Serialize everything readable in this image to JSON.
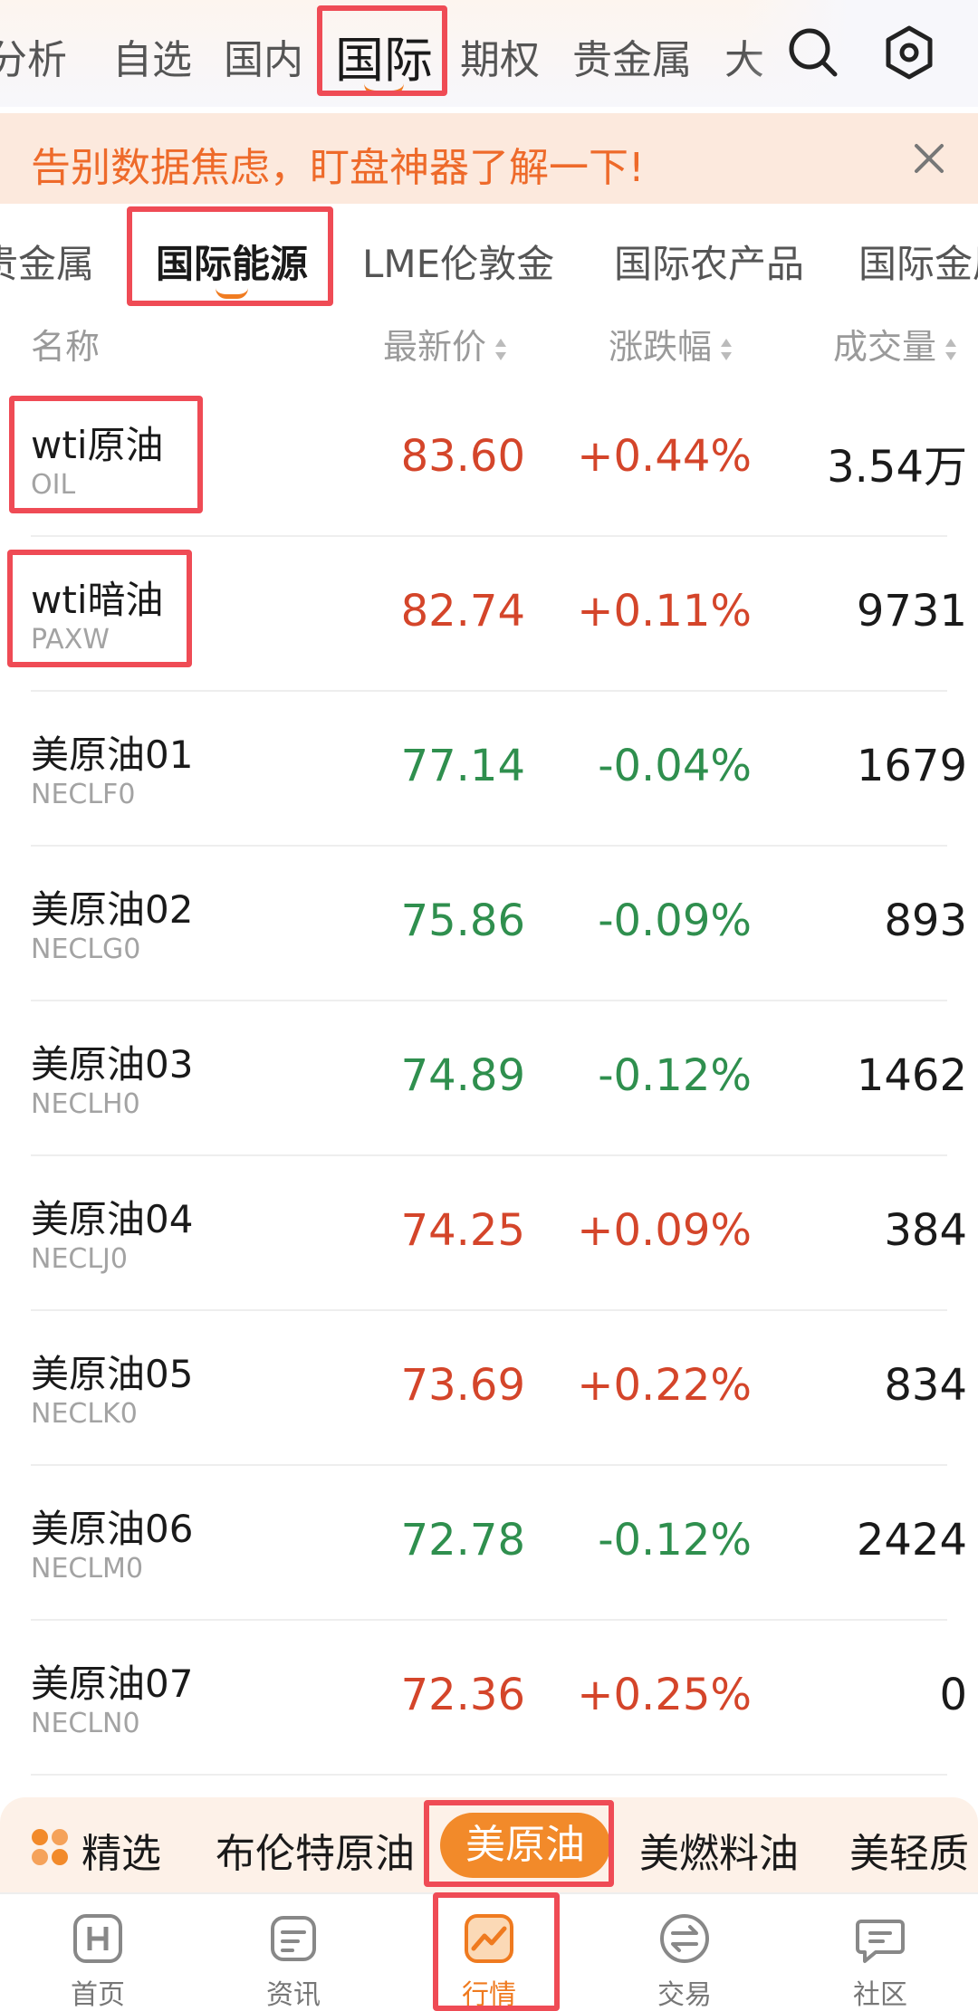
{
  "top_tabs": {
    "items": [
      "分析",
      "自选",
      "国内",
      "国际",
      "期权",
      "贵金属",
      "大"
    ],
    "active_index": 3
  },
  "banner": {
    "text": "告别数据焦虑，盯盘神器了解一下!"
  },
  "sub_tabs": {
    "items": [
      "贵金属",
      "国际能源",
      "LME伦敦金",
      "国际农产品",
      "国际金属"
    ],
    "active_index": 1
  },
  "columns": {
    "name": "名称",
    "price": "最新价",
    "change": "涨跌幅",
    "volume": "成交量"
  },
  "rows": [
    {
      "name": "wti原油",
      "code": "OIL",
      "price": "83.60",
      "change": "+0.44%",
      "volume": "3.54万",
      "dir": "up"
    },
    {
      "name": "wti暗油",
      "code": "PAXW",
      "price": "82.74",
      "change": "+0.11%",
      "volume": "9731",
      "dir": "up"
    },
    {
      "name": "美原油01",
      "code": "NECLF0",
      "price": "77.14",
      "change": "-0.04%",
      "volume": "1679",
      "dir": "down"
    },
    {
      "name": "美原油02",
      "code": "NECLG0",
      "price": "75.86",
      "change": "-0.09%",
      "volume": "893",
      "dir": "down"
    },
    {
      "name": "美原油03",
      "code": "NECLH0",
      "price": "74.89",
      "change": "-0.12%",
      "volume": "1462",
      "dir": "down"
    },
    {
      "name": "美原油04",
      "code": "NECLJ0",
      "price": "74.25",
      "change": "+0.09%",
      "volume": "384",
      "dir": "up"
    },
    {
      "name": "美原油05",
      "code": "NECLK0",
      "price": "73.69",
      "change": "+0.22%",
      "volume": "834",
      "dir": "up"
    },
    {
      "name": "美原油06",
      "code": "NECLM0",
      "price": "72.78",
      "change": "-0.12%",
      "volume": "2424",
      "dir": "down"
    },
    {
      "name": "美原油07",
      "code": "NECLN0",
      "price": "72.36",
      "change": "+0.25%",
      "volume": "0",
      "dir": "up"
    }
  ],
  "categories": {
    "items": [
      "精选",
      "布伦特原油",
      "美原油",
      "美燃料油",
      "美轻质"
    ],
    "active_index": 2
  },
  "bottom_nav": {
    "items": [
      "首页",
      "资讯",
      "行情",
      "交易",
      "社区"
    ],
    "active_index": 2
  },
  "colors": {
    "accent": "#f07c21",
    "up": "#d4452a",
    "down": "#2f8f4e",
    "highlight": "#ef4b55",
    "banner_bg": "#fce9dd",
    "banner_text": "#ee6a2a"
  }
}
